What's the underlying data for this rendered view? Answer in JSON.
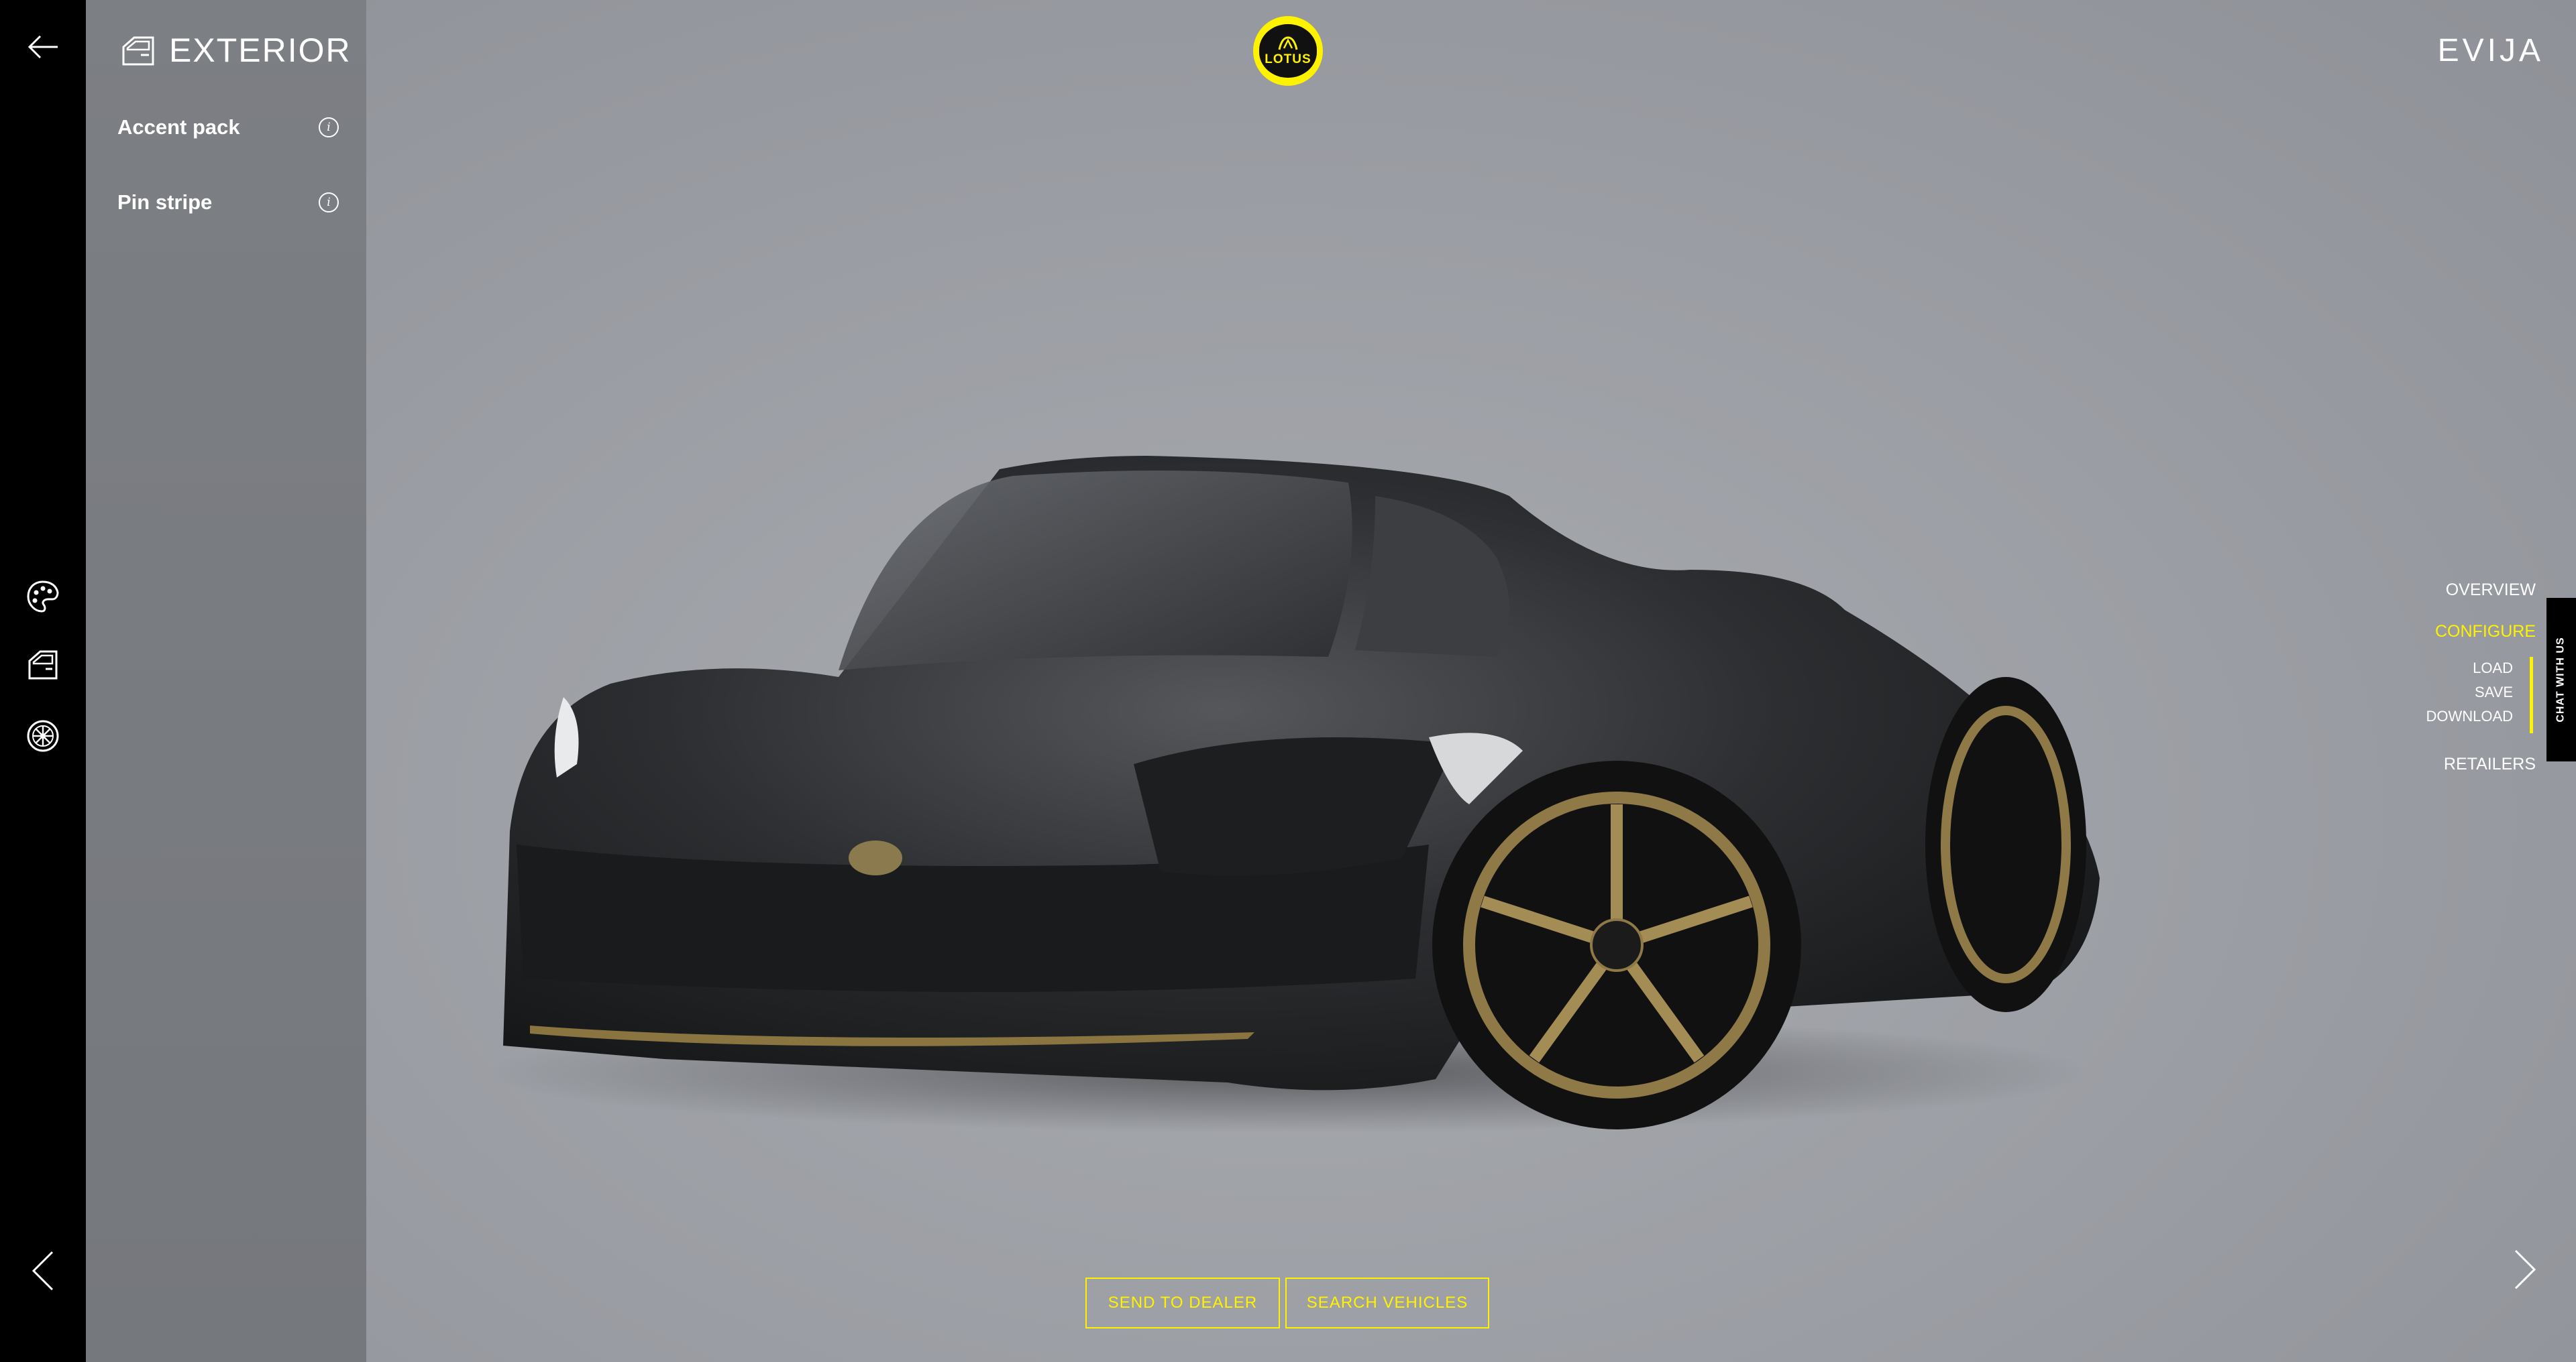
{
  "header": {
    "section_title": "EXTERIOR",
    "model_name": "EVIJA",
    "logo_text": "LOTUS"
  },
  "left_toolbar": {
    "items": [
      {
        "icon": "palette-icon"
      },
      {
        "icon": "car-door-icon"
      },
      {
        "icon": "wheel-icon"
      }
    ]
  },
  "options_panel": {
    "items": [
      {
        "label": "Accent pack",
        "info_icon": "info-icon"
      },
      {
        "label": "Pin stripe",
        "info_icon": "info-icon"
      }
    ]
  },
  "right_nav": {
    "overview": "OVERVIEW",
    "configure": "CONFIGURE",
    "load": "LOAD",
    "save": "SAVE",
    "download": "DOWNLOAD",
    "retailers": "RETAILERS",
    "chat": "CHAT WITH US"
  },
  "actions": {
    "send_to_dealer": "SEND TO DEALER",
    "search_vehicles": "SEARCH VEHICLES"
  },
  "colors": {
    "accent": "#fff200",
    "sidebar": "#000000",
    "panel": "#7a7d82",
    "background": "#9ea1a6"
  }
}
